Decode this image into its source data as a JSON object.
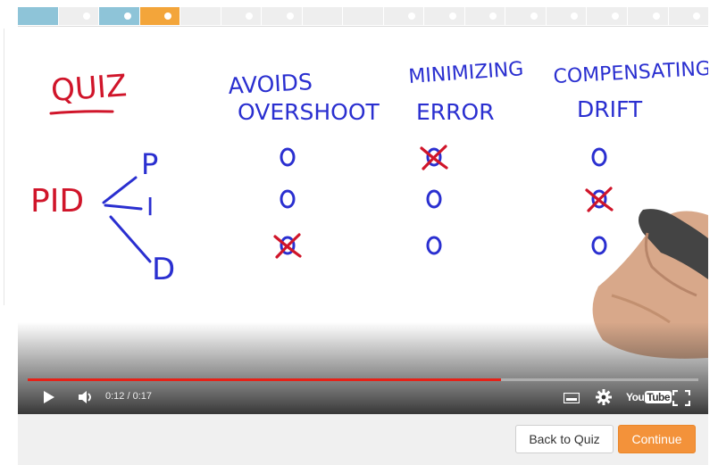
{
  "progress": {
    "segments": [
      {
        "state": "done",
        "color": "#8ec4d8",
        "dot": false
      },
      {
        "state": "plain",
        "color": "#eeeeee",
        "dot": true
      },
      {
        "state": "done",
        "color": "#8ec4d8",
        "dot": true
      },
      {
        "state": "current",
        "color": "#f3a53a",
        "dot": true
      },
      {
        "state": "plain",
        "color": "#eeeeee",
        "dot": false
      },
      {
        "state": "plain",
        "color": "#eeeeee",
        "dot": true
      },
      {
        "state": "plain",
        "color": "#eeeeee",
        "dot": true
      },
      {
        "state": "plain",
        "color": "#eeeeee",
        "dot": false
      },
      {
        "state": "plain",
        "color": "#eeeeee",
        "dot": false
      },
      {
        "state": "plain",
        "color": "#eeeeee",
        "dot": true
      },
      {
        "state": "plain",
        "color": "#eeeeee",
        "dot": true
      },
      {
        "state": "plain",
        "color": "#eeeeee",
        "dot": true
      },
      {
        "state": "plain",
        "color": "#eeeeee",
        "dot": true
      },
      {
        "state": "plain",
        "color": "#eeeeee",
        "dot": true
      },
      {
        "state": "plain",
        "color": "#eeeeee",
        "dot": true
      },
      {
        "state": "plain",
        "color": "#eeeeee",
        "dot": true
      },
      {
        "state": "plain",
        "color": "#eeeeee",
        "dot": true
      }
    ]
  },
  "whiteboard": {
    "quiz_label": "QUIZ",
    "pid_label": "PID",
    "branches": [
      "P",
      "I",
      "D"
    ],
    "columns": [
      "AVOIDS OVERSHOOT",
      "MINIMIZING ERROR",
      "COMPENSATING DRIFT"
    ],
    "column_lines": [
      [
        "AVOIDS",
        "OVERSHOOT"
      ],
      [
        "MINIMIZING",
        "ERROR"
      ],
      [
        "COMPENSATING",
        "DRIFT"
      ]
    ],
    "marks": [
      [
        "o",
        "x",
        "o"
      ],
      [
        "o",
        "o",
        "x"
      ],
      [
        "x",
        "o",
        "o"
      ]
    ]
  },
  "player": {
    "time_current": "0:12",
    "time_total": "0:17",
    "time_text": "0:12 / 0:17",
    "progress_fraction": 0.706,
    "brand": "YouTube",
    "brand_you": "You",
    "brand_tube": "Tube",
    "icons": [
      "play-icon",
      "volume-icon",
      "captions-icon",
      "gear-icon",
      "fullscreen-icon"
    ]
  },
  "actions": {
    "back_label": "Back to Quiz",
    "continue_label": "Continue"
  },
  "colors": {
    "accent": "#f3923a",
    "marker_red": "#d0152a",
    "marker_blue": "#2a2fd0",
    "scrub_red": "#e62117"
  }
}
